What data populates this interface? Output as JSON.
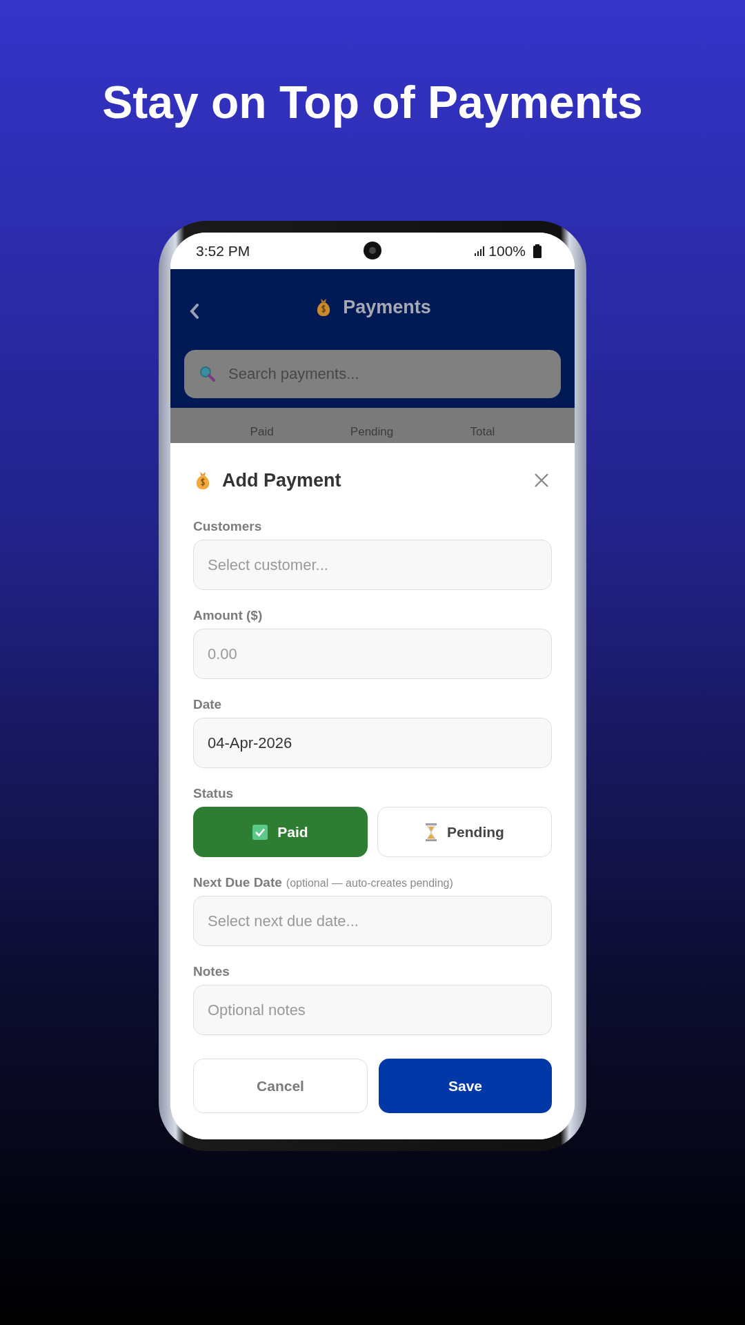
{
  "headline": "Stay on Top of Payments",
  "status_bar": {
    "time": "3:52 PM",
    "battery": "100%"
  },
  "header": {
    "title": "Payments"
  },
  "search": {
    "placeholder": "Search payments..."
  },
  "summary": [
    "Paid",
    "Pending",
    "Total"
  ],
  "dialog": {
    "title": "Add Payment",
    "fields": [
      {
        "label": "Customers",
        "placeholder": "Select customer..."
      },
      {
        "label": "Amount ($)",
        "placeholder": "0.00"
      },
      {
        "label": "Date",
        "value": "04-Apr-2026"
      }
    ],
    "status": {
      "label": "Status",
      "options": [
        {
          "label": "Paid",
          "kind": "paid",
          "selected": true
        },
        {
          "label": "Pending",
          "kind": "pending",
          "selected": false
        }
      ]
    },
    "more_fields": [
      {
        "label": "Next Due Date",
        "hint": "(optional — auto-creates pending)",
        "placeholder": "Select next due date..."
      },
      {
        "label": "Notes",
        "placeholder": "Optional notes"
      }
    ],
    "buttons": [
      {
        "label": "Cancel",
        "kind": "secondary"
      },
      {
        "label": "Save",
        "kind": "primary"
      }
    ]
  }
}
